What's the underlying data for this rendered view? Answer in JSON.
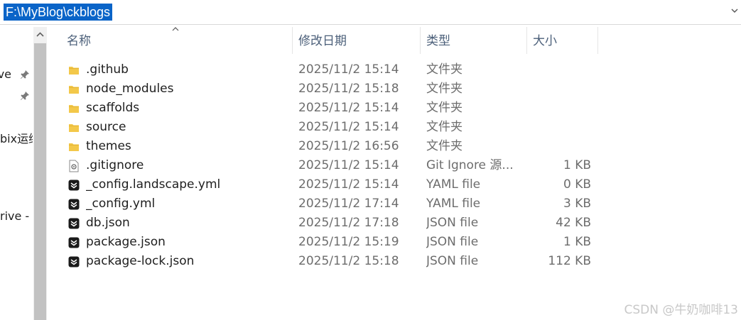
{
  "address": {
    "path": "F:\\MyBlog\\ckblogs"
  },
  "nav": {
    "items": [
      {
        "label": "ve",
        "pinned": true
      },
      {
        "label": "",
        "pinned": true
      },
      {
        "label": "bix运维",
        "pinned": false
      },
      {
        "label": "rive -",
        "pinned": false
      }
    ]
  },
  "columns": {
    "name": "名称",
    "date": "修改日期",
    "type": "类型",
    "size": "大小"
  },
  "files": [
    {
      "name": ".github",
      "date": "2025/11/2 15:14",
      "type": "文件夹",
      "size": "",
      "icon": "folder-icon"
    },
    {
      "name": "node_modules",
      "date": "2025/11/2 15:18",
      "type": "文件夹",
      "size": "",
      "icon": "folder-icon"
    },
    {
      "name": "scaffolds",
      "date": "2025/11/2 15:14",
      "type": "文件夹",
      "size": "",
      "icon": "folder-icon"
    },
    {
      "name": "source",
      "date": "2025/11/2 15:14",
      "type": "文件夹",
      "size": "",
      "icon": "folder-icon"
    },
    {
      "name": "themes",
      "date": "2025/11/2 16:56",
      "type": "文件夹",
      "size": "",
      "icon": "folder-icon"
    },
    {
      "name": ".gitignore",
      "date": "2025/11/2 15:14",
      "type": "Git Ignore 源...",
      "size": "1 KB",
      "icon": "settings-file-icon"
    },
    {
      "name": "_config.landscape.yml",
      "date": "2025/11/2 15:14",
      "type": "YAML file",
      "size": "0 KB",
      "icon": "code-file-icon"
    },
    {
      "name": "_config.yml",
      "date": "2025/11/2 17:14",
      "type": "YAML file",
      "size": "3 KB",
      "icon": "code-file-icon"
    },
    {
      "name": "db.json",
      "date": "2025/11/2 17:18",
      "type": "JSON file",
      "size": "42 KB",
      "icon": "code-file-icon"
    },
    {
      "name": "package.json",
      "date": "2025/11/2 15:19",
      "type": "JSON file",
      "size": "1 KB",
      "icon": "code-file-icon"
    },
    {
      "name": "package-lock.json",
      "date": "2025/11/2 15:18",
      "type": "JSON file",
      "size": "112 KB",
      "icon": "code-file-icon"
    }
  ],
  "watermark": "CSDN @牛奶咖啡13",
  "colors": {
    "selection": "#0a64c8",
    "folder": "#f3c84a",
    "header_text": "#4c607a"
  }
}
